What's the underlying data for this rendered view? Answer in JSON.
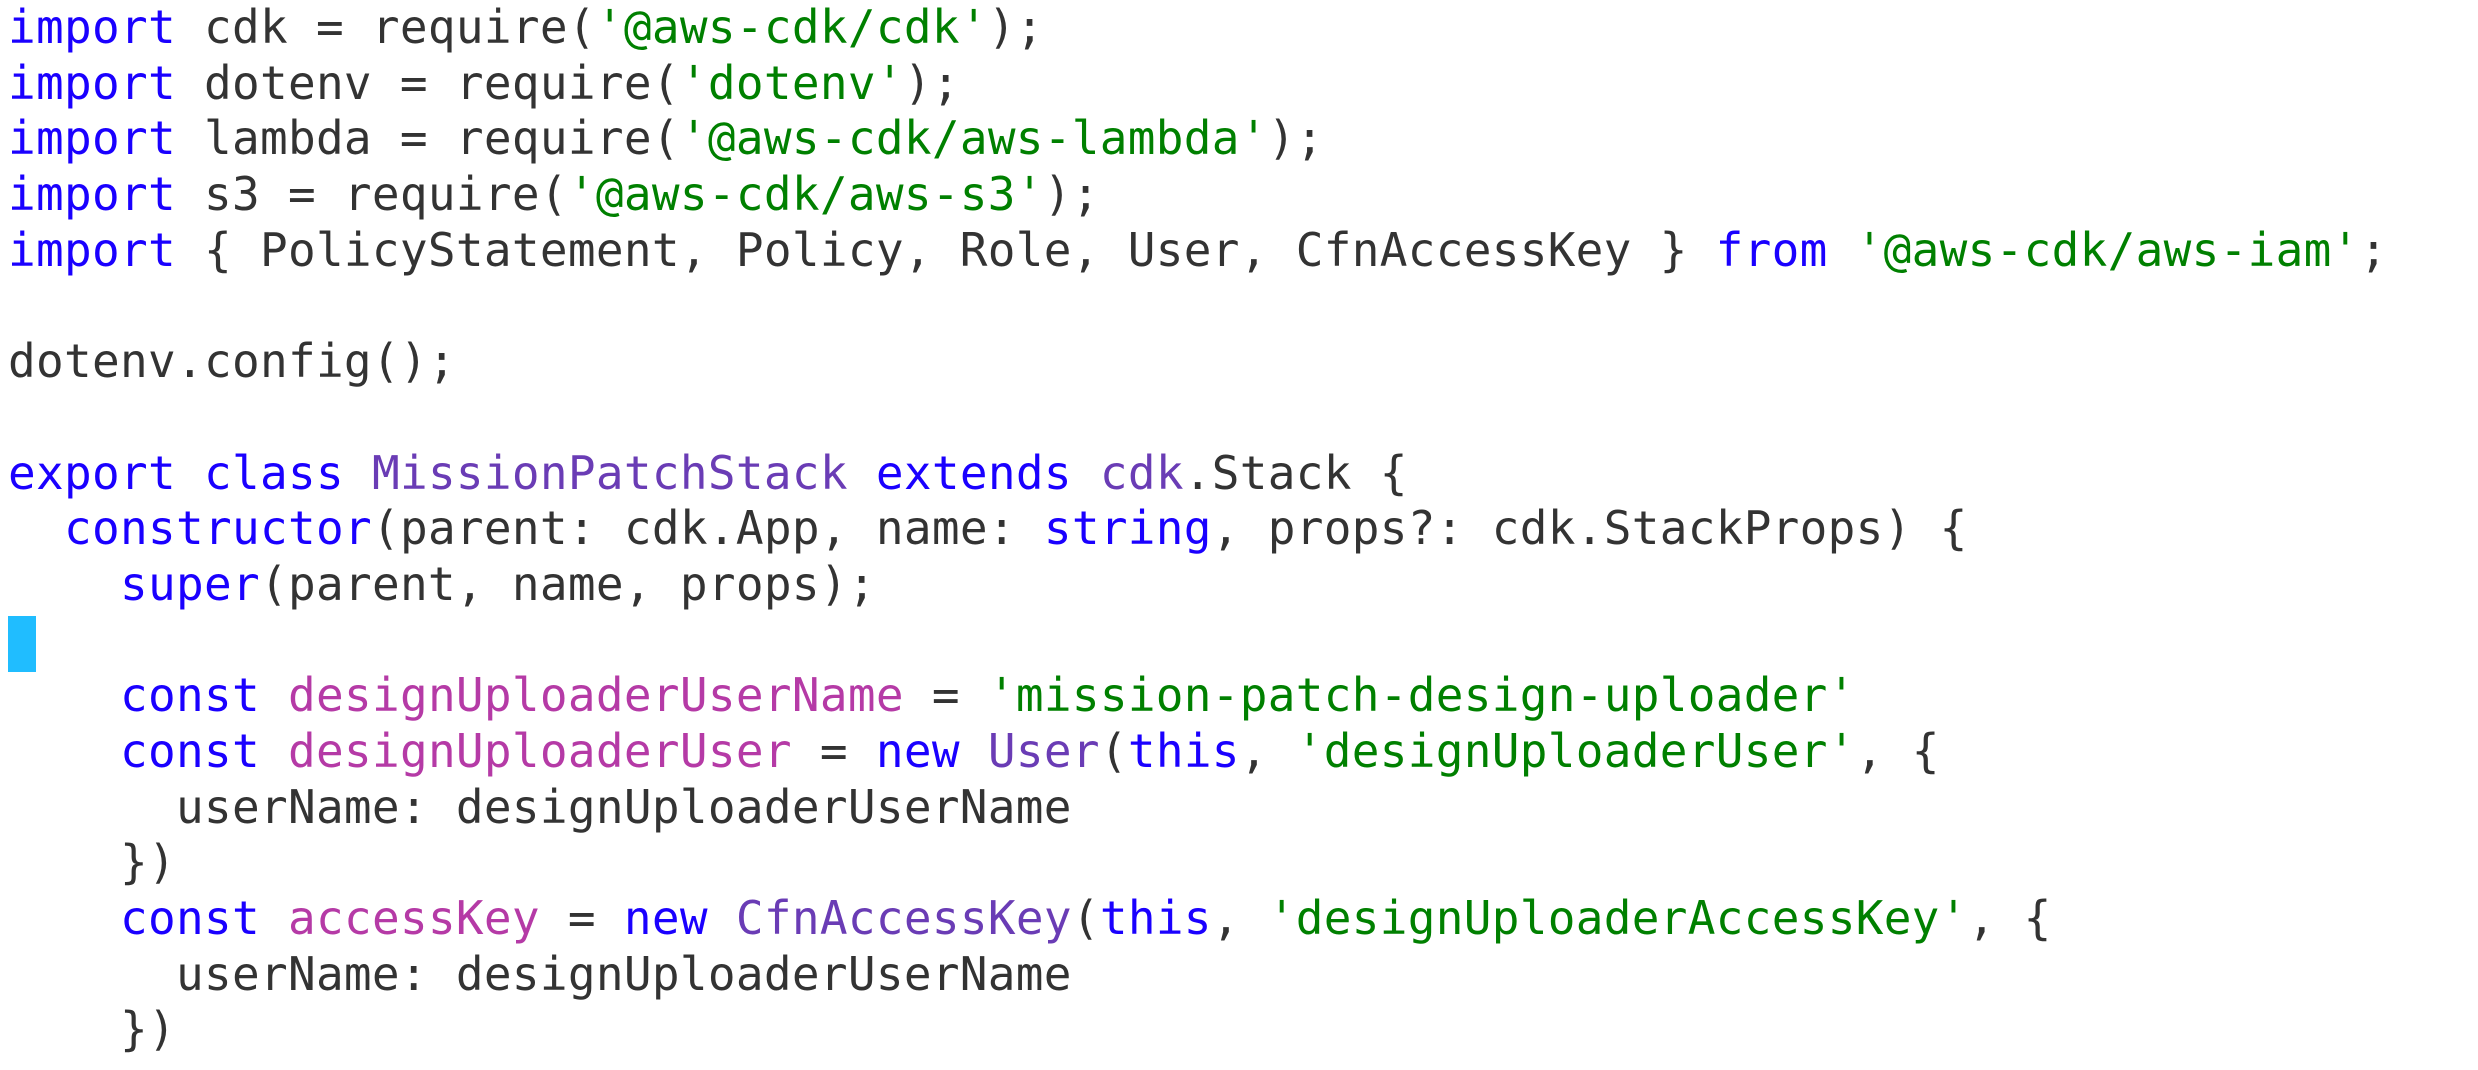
{
  "editor": {
    "language": "typescript",
    "colors": {
      "keyword": "#1a00ff",
      "string": "#008000",
      "class": "#6a3cb5",
      "variable": "#b53aa6",
      "default": "#333333",
      "cursor": "#20bdff"
    },
    "cursor": {
      "line": 12,
      "column": 1
    },
    "lines": [
      [
        [
          "kw",
          "import"
        ],
        [
          "def",
          " cdk = require("
        ],
        [
          "str",
          "'@aws-cdk/cdk'"
        ],
        [
          "def",
          ");"
        ]
      ],
      [
        [
          "kw",
          "import"
        ],
        [
          "def",
          " dotenv = require("
        ],
        [
          "str",
          "'dotenv'"
        ],
        [
          "def",
          ");"
        ]
      ],
      [
        [
          "kw",
          "import"
        ],
        [
          "def",
          " lambda = require("
        ],
        [
          "str",
          "'@aws-cdk/aws-lambda'"
        ],
        [
          "def",
          ");"
        ]
      ],
      [
        [
          "kw",
          "import"
        ],
        [
          "def",
          " s3 = require("
        ],
        [
          "str",
          "'@aws-cdk/aws-s3'"
        ],
        [
          "def",
          ");"
        ]
      ],
      [
        [
          "kw",
          "import"
        ],
        [
          "def",
          " { PolicyStatement, Policy, Role, User, CfnAccessKey } "
        ],
        [
          "kw",
          "from"
        ],
        [
          "def",
          " "
        ],
        [
          "str",
          "'@aws-cdk/aws-iam'"
        ],
        [
          "def",
          ";"
        ]
      ],
      [],
      [
        [
          "def",
          "dotenv.config();"
        ]
      ],
      [],
      [
        [
          "kw",
          "export"
        ],
        [
          "def",
          " "
        ],
        [
          "kw",
          "class"
        ],
        [
          "def",
          " "
        ],
        [
          "cls",
          "MissionPatchStack"
        ],
        [
          "def",
          " "
        ],
        [
          "kw",
          "extends"
        ],
        [
          "def",
          " "
        ],
        [
          "cls",
          "cdk"
        ],
        [
          "def",
          ".Stack {"
        ]
      ],
      [
        [
          "def",
          "  "
        ],
        [
          "kw",
          "constructor"
        ],
        [
          "def",
          "(parent: cdk.App, name: "
        ],
        [
          "kw",
          "string"
        ],
        [
          "def",
          ", props?: cdk.StackProps) {"
        ]
      ],
      [
        [
          "def",
          "    "
        ],
        [
          "kw",
          "super"
        ],
        [
          "def",
          "(parent, name, props);"
        ]
      ],
      [],
      [
        [
          "def",
          "    "
        ],
        [
          "kw",
          "const"
        ],
        [
          "def",
          " "
        ],
        [
          "var",
          "designUploaderUserName"
        ],
        [
          "def",
          " = "
        ],
        [
          "str",
          "'mission-patch-design-uploader'"
        ]
      ],
      [
        [
          "def",
          "    "
        ],
        [
          "kw",
          "const"
        ],
        [
          "def",
          " "
        ],
        [
          "var",
          "designUploaderUser"
        ],
        [
          "def",
          " = "
        ],
        [
          "kw",
          "new"
        ],
        [
          "def",
          " "
        ],
        [
          "cls",
          "User"
        ],
        [
          "def",
          "("
        ],
        [
          "kw",
          "this"
        ],
        [
          "def",
          ", "
        ],
        [
          "str",
          "'designUploaderUser'"
        ],
        [
          "def",
          ", {"
        ]
      ],
      [
        [
          "def",
          "      userName: designUploaderUserName"
        ]
      ],
      [
        [
          "def",
          "    })"
        ]
      ],
      [
        [
          "def",
          "    "
        ],
        [
          "kw",
          "const"
        ],
        [
          "def",
          " "
        ],
        [
          "var",
          "accessKey"
        ],
        [
          "def",
          " = "
        ],
        [
          "kw",
          "new"
        ],
        [
          "def",
          " "
        ],
        [
          "cls",
          "CfnAccessKey"
        ],
        [
          "def",
          "("
        ],
        [
          "kw",
          "this"
        ],
        [
          "def",
          ", "
        ],
        [
          "str",
          "'designUploaderAccessKey'"
        ],
        [
          "def",
          ", {"
        ]
      ],
      [
        [
          "def",
          "      userName: designUploaderUserName"
        ]
      ],
      [
        [
          "def",
          "    })"
        ]
      ]
    ]
  }
}
